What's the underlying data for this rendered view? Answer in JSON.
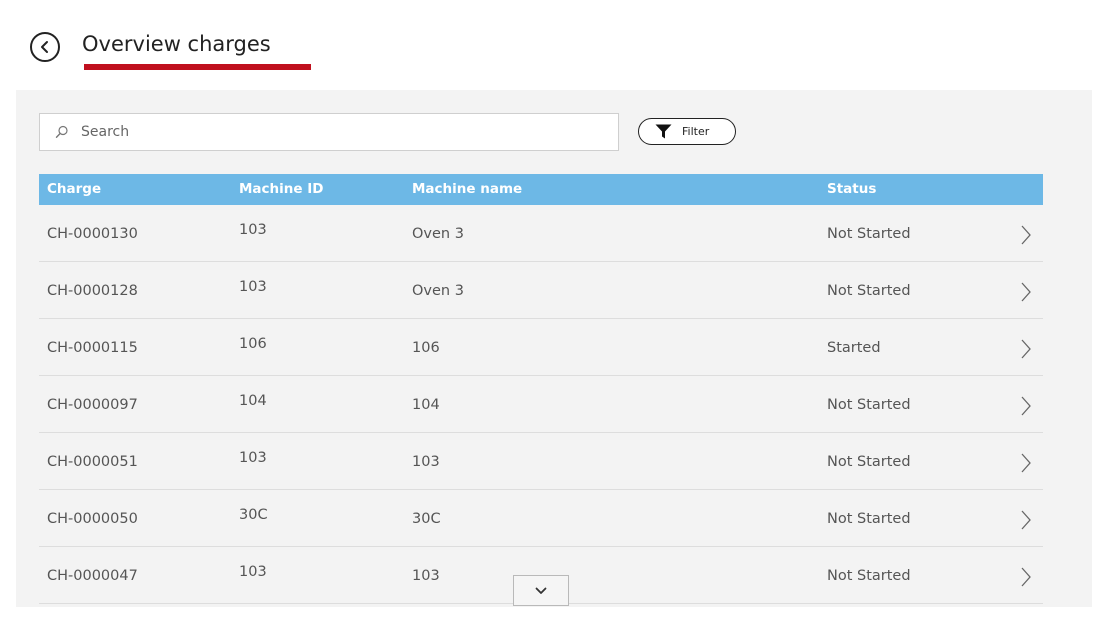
{
  "header": {
    "title": "Overview charges",
    "accent_color": "#c0101e"
  },
  "search": {
    "placeholder": "Search",
    "value": ""
  },
  "filter": {
    "label": "Filter"
  },
  "table": {
    "header_color": "#6db8e6",
    "columns": [
      "Charge",
      "Machine ID",
      "Machine name",
      "Status"
    ],
    "rows": [
      {
        "charge": "CH-0000130",
        "machine_id": "103",
        "machine_name": "Oven 3",
        "status": "Not Started"
      },
      {
        "charge": "CH-0000128",
        "machine_id": "103",
        "machine_name": "Oven 3",
        "status": "Not Started"
      },
      {
        "charge": "CH-0000115",
        "machine_id": "106",
        "machine_name": "106",
        "status": "Started"
      },
      {
        "charge": "CH-0000097",
        "machine_id": "104",
        "machine_name": "104",
        "status": "Not Started"
      },
      {
        "charge": "CH-0000051",
        "machine_id": "103",
        "machine_name": "103",
        "status": "Not Started"
      },
      {
        "charge": "CH-0000050",
        "machine_id": "30C",
        "machine_name": "30C",
        "status": "Not Started"
      },
      {
        "charge": "CH-0000047",
        "machine_id": "103",
        "machine_name": "103",
        "status": "Not Started"
      }
    ]
  },
  "icons": {
    "back": "chevron-left-circle-icon",
    "search": "search-icon",
    "filter": "funnel-icon",
    "row_chevron": "chevron-right-icon",
    "scroll": "chevron-down-icon"
  }
}
